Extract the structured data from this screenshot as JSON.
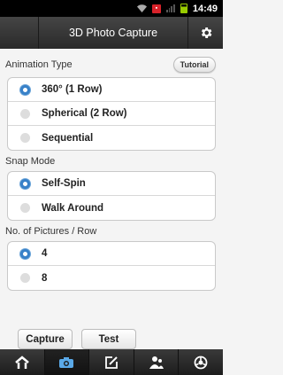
{
  "statusbar": {
    "time": "14:49",
    "icons": [
      "wifi-icon",
      "notification-icon",
      "signal-icon",
      "battery-icon"
    ]
  },
  "header": {
    "title": "3D Photo Capture",
    "settings_icon": "gear-icon"
  },
  "animation": {
    "label": "Animation Type",
    "tutorial_label": "Tutorial",
    "options": [
      {
        "label": "360° (1 Row)",
        "selected": true
      },
      {
        "label": "Spherical (2 Row)",
        "selected": false
      },
      {
        "label": "Sequential",
        "selected": false
      }
    ]
  },
  "snap": {
    "label": "Snap Mode",
    "options": [
      {
        "label": "Self-Spin",
        "selected": true
      },
      {
        "label": "Walk Around",
        "selected": false
      }
    ]
  },
  "pictures": {
    "label": "No. of Pictures / Row",
    "options": [
      {
        "label": "4",
        "selected": true
      },
      {
        "label": "8",
        "selected": false
      }
    ]
  },
  "actions": {
    "capture_label": "Capture",
    "test_label": "Test"
  },
  "tabs": [
    {
      "icon": "home-icon",
      "active": false
    },
    {
      "icon": "camera-icon",
      "active": true
    },
    {
      "icon": "edit-icon",
      "active": false
    },
    {
      "icon": "people-icon",
      "active": false
    },
    {
      "icon": "share-icon",
      "active": false
    }
  ],
  "colors": {
    "accent": "#3881c8",
    "header": "#333333",
    "background": "#f4f4f4"
  }
}
